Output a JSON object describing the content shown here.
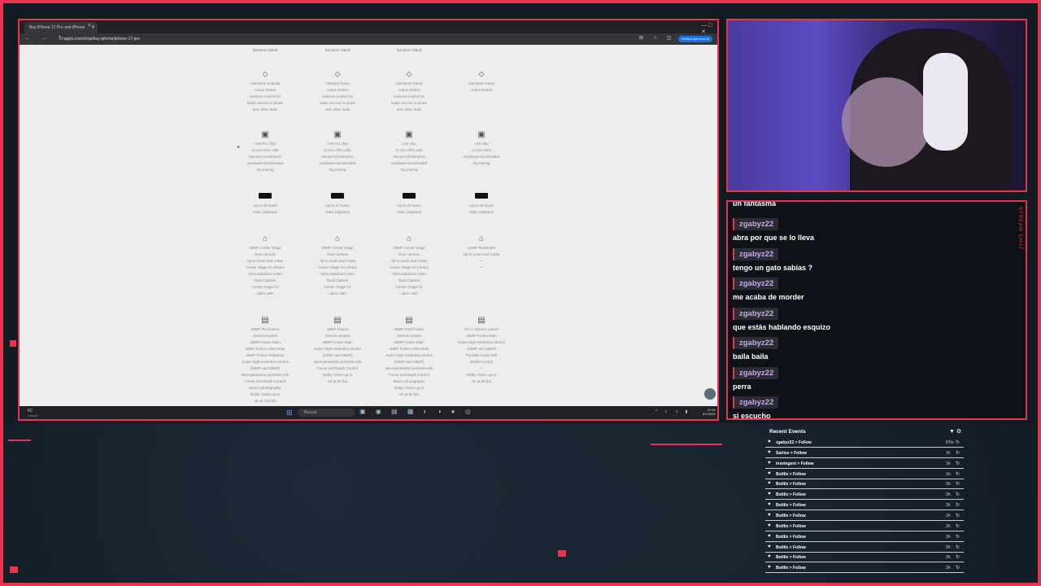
{
  "browser": {
    "tab_title": "Buy iPhone 17 Pro and iPhone",
    "tab_close": "×",
    "new_tab": "+",
    "window_controls": "— □ ✕",
    "nav_icons": "← → ↻",
    "url": "apple.com/shop/buy-iphone/iphone-17-pro",
    "extension_icons": "⊞ ☆ ◫",
    "verify_badge": "Verifica que eres tú"
  },
  "compare": {
    "columns": [
      {
        "top": "Dynamic Island",
        "design": [
          "Aluminum unibody",
          "Action button",
          "Camera Control for",
          "faster access to photo",
          "and video tools"
        ],
        "chip": [
          "A19 Pro chip",
          "6-core GPU with",
          "Neural Accelerators",
          "Hardware-accelerated",
          "ray tracing"
        ],
        "battery": [
          "Up to 39 hours",
          "video playback"
        ],
        "front": [
          "18MP Center Stage",
          "front camera",
          "Up to zoom and rotate",
          "Center Stage for photos",
          "Ultra-stabilized video",
          "Dual Capture",
          "Center Stage for",
          "video calls"
        ],
        "camera": [
          "48MP Pro Fusion",
          "camera system",
          "48MP Fusion Main",
          "48MP Fusion Ultra Wide",
          "48MP Fusion Telephoto",
          "Super-high-resolution photos",
          "(24MP and 48MP)",
          "Next-generation portraits with",
          "Focus and Depth Control",
          "Macro photography",
          "Dolby Vision up to",
          "4K at 120 fps"
        ]
      },
      {
        "top": "Dynamic Island",
        "design": [
          "Titanium frame",
          "Action button",
          "Camera Control for",
          "faster access to photo",
          "and video tools"
        ],
        "chip": [
          "A19 Pro chip",
          "6-core GPU with",
          "Neural Accelerators",
          "Hardware-accelerated",
          "ray tracing"
        ],
        "battery": [
          "Up to 27 hours",
          "video playback"
        ],
        "front": [
          "18MP Center Stage",
          "front camera",
          "Up to zoom and rotate",
          "Center Stage for photos",
          "Ultra-stabilized video",
          "Dual Capture",
          "Center Stage for",
          "video calls"
        ],
        "camera": [
          "48MP Fusion",
          "camera system",
          "48MP Fusion Main",
          "",
          "",
          "Super-high-resolution photos",
          "(24MP and 48MP)",
          "Next-generation portraits with",
          "Focus and Depth Control",
          "",
          "Dolby Vision up to",
          "4K at 60 fps"
        ]
      },
      {
        "top": "Dynamic Island",
        "design": [
          "Aluminum frame",
          "Action button",
          "Camera Control for",
          "faster access to photo",
          "and video tools"
        ],
        "chip": [
          "A19 chip",
          "5-core GPU with",
          "Neural Accelerators",
          "Hardware-accelerated",
          "ray tracing"
        ],
        "battery": [
          "Up to 30 hours",
          "video playback"
        ],
        "front": [
          "18MP Center Stage",
          "front camera",
          "Up to zoom and rotate",
          "Center Stage for photos",
          "Ultra-stabilized video",
          "Dual Capture",
          "Center Stage for",
          "video calls"
        ],
        "camera": [
          "48MP Dual Fusion",
          "camera system",
          "48MP Fusion Main",
          "48MP Fusion Ultra Wide",
          "",
          "Super-high-resolution photos",
          "(24MP and 48MP)",
          "Next-generation portraits with",
          "Focus and Depth Control",
          "Macro photography",
          "Dolby Vision up to",
          "4K at 60 fps"
        ]
      },
      {
        "top": "",
        "design": [
          "Aluminum frame",
          "Action button",
          "",
          "",
          ""
        ],
        "chip": [
          "A18 chip",
          "4-core GPU",
          "",
          "Hardware-accelerated",
          "ray tracing"
        ],
        "battery": [
          "Up to 26 hours",
          "video playback"
        ],
        "front": [
          "12MP TrueDepth",
          "",
          "Up to zoom and rotate",
          "—",
          "—",
          "",
          "",
          ""
        ],
        "camera": [
          "2-in-1 camera system",
          "",
          "48MP Fusion Main",
          "",
          "",
          "Super-high-resolution photos",
          "(24MP and 48MP)",
          "Portraits mode with",
          "Depth Control",
          "—",
          "Dolby Vision up to",
          "4K at 60 fps"
        ]
      }
    ],
    "icons": {
      "design": "⬦",
      "chip": "▣",
      "front": "⌂",
      "camera": "▤"
    }
  },
  "taskbar": {
    "weather_temp": "6C",
    "weather_desc": "Cloudy",
    "start_icon": "⊞",
    "search_placeholder": "Buscar",
    "app_icons": "▣ ◉ ▤ ▦ ◐ ◑ ● ◎",
    "tray_icons": "^ ◐ ◑ ▮",
    "clock_time": "21:08",
    "clock_date": "8/1/2025"
  },
  "chat": {
    "vertical_label": "STREAM CHAT",
    "first_message": "un fantasma",
    "messages": [
      {
        "user": "zgabyz22",
        "text": "abra por que se lo lleva"
      },
      {
        "user": "zgabyz22",
        "text": "tengo un gato sabías ?"
      },
      {
        "user": "zgabyz22",
        "text": "me acaba de morder"
      },
      {
        "user": "zgabyz22",
        "text": "que estás hablando esquizo"
      },
      {
        "user": "zgabyz22",
        "text": "baila baila"
      },
      {
        "user": "zgabyz22",
        "text": "perra"
      },
      {
        "user": "zgabyz22",
        "text": "si escucho"
      }
    ]
  },
  "events": {
    "title": "Recent Events",
    "filter_icon": "▼ ⚙",
    "items": [
      {
        "name": "zgabyz22 > Follow",
        "time": "57m"
      },
      {
        "name": "Sariiss > Follow",
        "time": "1h"
      },
      {
        "name": "insvingent > Follow",
        "time": "1h"
      },
      {
        "name": "Botlilx > Follow",
        "time": "1h"
      },
      {
        "name": "Botlilx > Follow",
        "time": "2h"
      },
      {
        "name": "Botlilx > Follow",
        "time": "2h"
      },
      {
        "name": "Botlilx > Follow",
        "time": "2h"
      },
      {
        "name": "Botlilx > Follow",
        "time": "2h"
      },
      {
        "name": "Botlilx > Follow",
        "time": "2h"
      },
      {
        "name": "Botlilx > Follow",
        "time": "2h"
      },
      {
        "name": "Botlilx > Follow",
        "time": "2h"
      },
      {
        "name": "Botlilx > Follow",
        "time": "2h"
      },
      {
        "name": "Botlilx > Follow",
        "time": "2h"
      }
    ],
    "heart_icon": "♥",
    "replay_icon": "↻"
  },
  "colors": {
    "accent": "#e8344e",
    "chat_user": "#c7a8e8",
    "background": "#121a22"
  }
}
